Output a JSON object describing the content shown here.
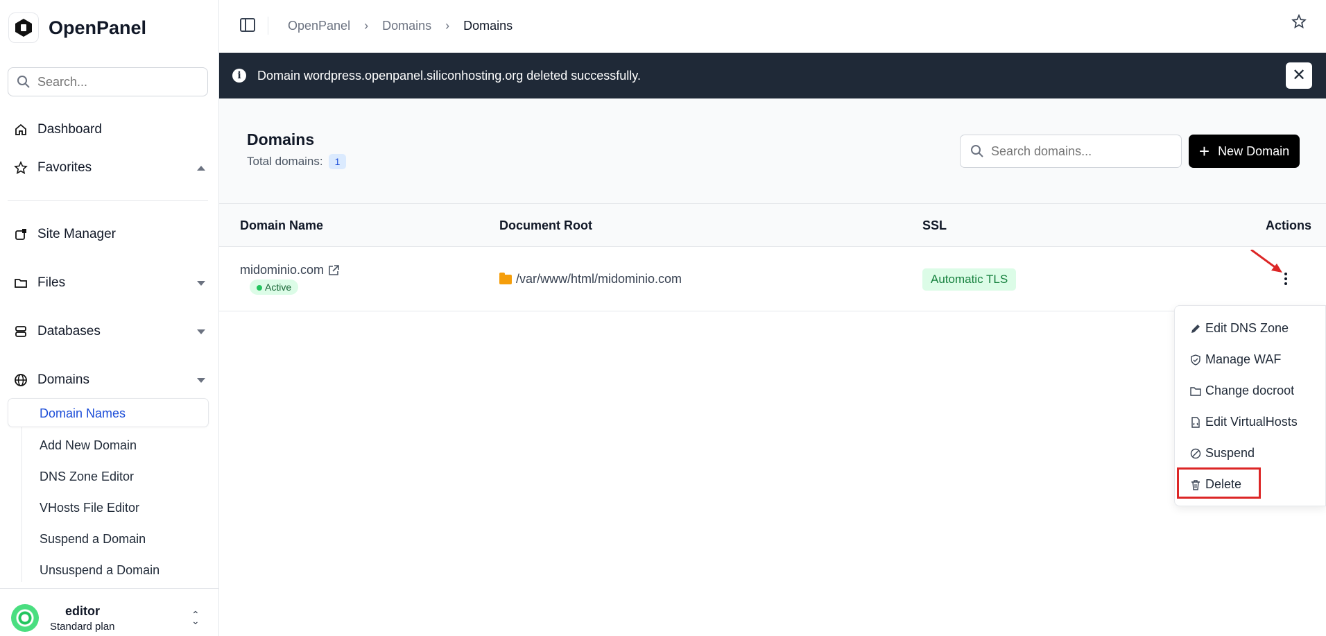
{
  "app": {
    "name": "OpenPanel"
  },
  "sidebar": {
    "search_placeholder": "Search...",
    "items": [
      {
        "label": "Dashboard",
        "icon": "home-icon"
      },
      {
        "label": "Favorites",
        "icon": "star-icon"
      },
      {
        "label": "Site Manager",
        "icon": "external-box-icon"
      },
      {
        "label": "Files",
        "icon": "folder-icon"
      },
      {
        "label": "Databases",
        "icon": "database-icon"
      },
      {
        "label": "Domains",
        "icon": "globe-icon"
      }
    ],
    "domains_sub": [
      "Domain Names",
      "Add New Domain",
      "DNS Zone Editor",
      "VHosts File Editor",
      "Suspend a Domain",
      "Unsuspend a Domain"
    ],
    "user": {
      "name": "editor",
      "plan": "Standard plan"
    }
  },
  "topbar": {
    "breadcrumbs": [
      "OpenPanel",
      "Domains",
      "Domains"
    ]
  },
  "alert": {
    "message": "Domain wordpress.openpanel.siliconhosting.org deleted successfully."
  },
  "page": {
    "title": "Domains",
    "total_label": "Total domains:",
    "total_count": "1",
    "search_placeholder": "Search domains...",
    "new_button": "New Domain"
  },
  "table": {
    "columns": [
      "Domain Name",
      "Document Root",
      "SSL",
      "Actions"
    ],
    "rows": [
      {
        "domain": "midominio.com",
        "status": "Active",
        "docroot": "/var/www/html/midominio.com",
        "ssl": "Automatic TLS"
      }
    ]
  },
  "menu": {
    "items": [
      {
        "label": "Edit DNS Zone",
        "icon": "pencil-icon"
      },
      {
        "label": "Manage WAF",
        "icon": "shield-icon"
      },
      {
        "label": "Change docroot",
        "icon": "folder-icon"
      },
      {
        "label": "Edit VirtualHosts",
        "icon": "file-code-icon"
      },
      {
        "label": "Suspend",
        "icon": "ban-icon"
      },
      {
        "label": "Delete",
        "icon": "trash-icon"
      }
    ]
  },
  "colors": {
    "alert_bg": "#1f2937",
    "primary_button": "#000000",
    "active_link": "#1d4ed8",
    "annotation": "#dc2626",
    "status_green": "#22c55e"
  }
}
